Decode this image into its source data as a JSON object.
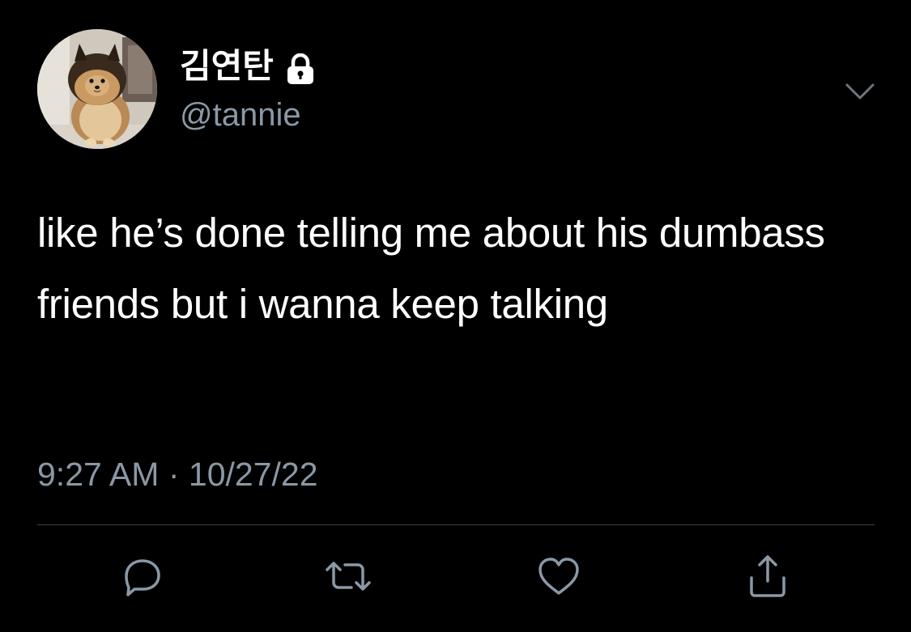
{
  "user": {
    "display_name": "김연탄",
    "handle": "@tannie",
    "locked": true
  },
  "tweet": {
    "text": "like he’s done telling me about his dumbass friends but i wanna keep talking",
    "time": "9:27 AM",
    "separator": "·",
    "date": "10/27/22"
  },
  "icons": {
    "lock": "lock-icon",
    "more": "chevron-down-icon",
    "reply": "reply-icon",
    "retweet": "retweet-icon",
    "like": "heart-icon",
    "share": "share-icon"
  },
  "colors": {
    "background": "#000000",
    "text": "#ffffff",
    "secondary": "#8b98a5",
    "divider": "#38444d"
  }
}
